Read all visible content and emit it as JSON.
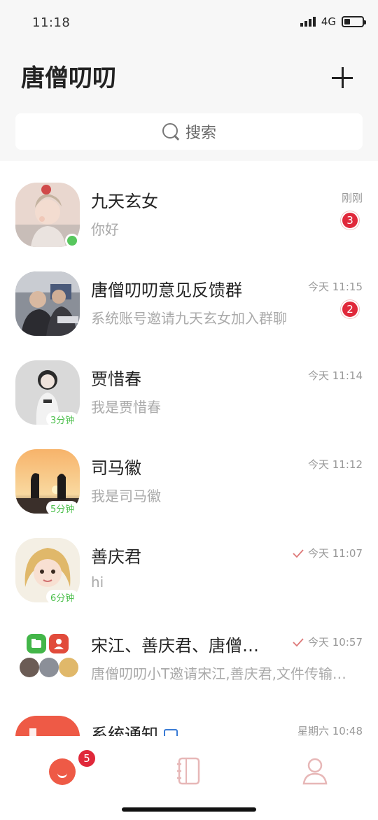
{
  "status_bar": {
    "time": "11:18",
    "network": "4G",
    "battery_level": 0.35
  },
  "header": {
    "title": "唐僧叨叨",
    "add_icon": "plus-icon"
  },
  "search": {
    "placeholder": "搜索",
    "icon": "search-icon"
  },
  "colors": {
    "accent": "#ee5a46",
    "badge": "#e0283a",
    "online": "#57c75d",
    "duration": "#4cbf4c",
    "muted_text": "#aaaaaa"
  },
  "conversations": [
    {
      "name": "九天玄女",
      "preview": "你好",
      "time": "刚刚",
      "unread": "3",
      "online": true
    },
    {
      "name": "唐僧叨叨意见反馈群",
      "preview": "系统账号邀请九天玄女加入群聊",
      "time": "今天 11:15",
      "unread": "2"
    },
    {
      "name": "贾惜春",
      "preview": "我是贾惜春",
      "time": "今天 11:14",
      "duration": "3分钟"
    },
    {
      "name": "司马徽",
      "preview": "我是司马徽",
      "time": "今天 11:12",
      "duration": "5分钟"
    },
    {
      "name": "善庆君",
      "preview": "hi",
      "time": "今天 11:07",
      "duration": "6分钟",
      "sent_check": true
    },
    {
      "name": "宋江、善庆君、唐僧…",
      "preview": "唐僧叨叨小T邀请宋江,善庆君,文件传输…",
      "time": "今天 10:57",
      "sent_check": true
    },
    {
      "name": "系统通知",
      "preview": "",
      "time": "星期六 10:48",
      "official_badge": true
    }
  ],
  "tabbar": {
    "tabs": [
      {
        "name": "chat",
        "icon": "chat-bubble-icon",
        "badge": "5",
        "active": true
      },
      {
        "name": "contacts",
        "icon": "address-book-icon"
      },
      {
        "name": "me",
        "icon": "person-icon"
      }
    ]
  }
}
